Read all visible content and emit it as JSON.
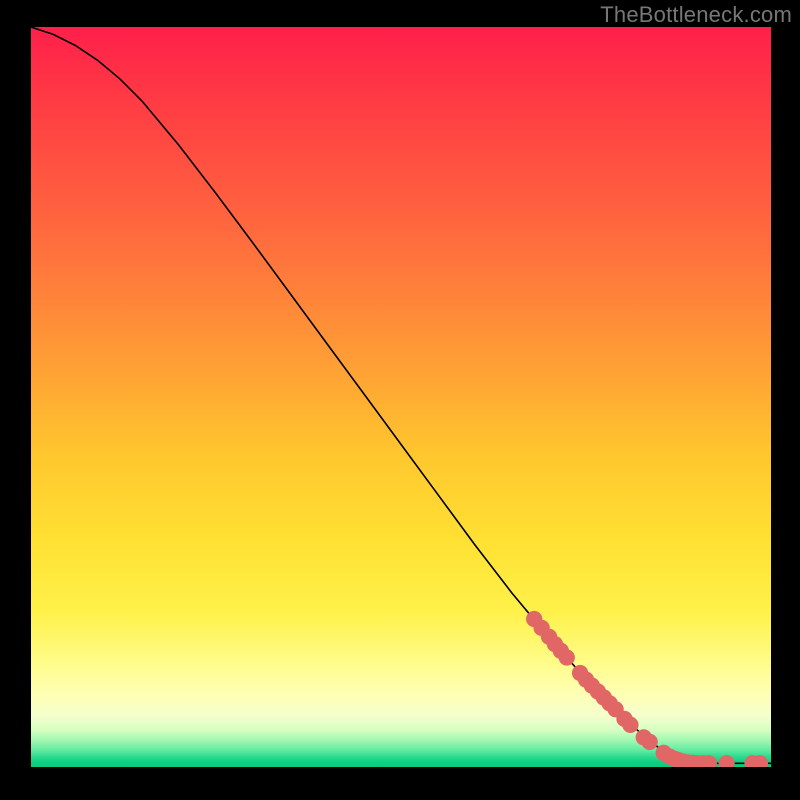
{
  "watermark": "TheBottleneck.com",
  "chart_data": {
    "type": "line",
    "title": "",
    "xlabel": "",
    "ylabel": "",
    "xlim": [
      0,
      100
    ],
    "ylim": [
      0,
      100
    ],
    "curve": [
      {
        "x": 0,
        "y": 100
      },
      {
        "x": 3,
        "y": 99.0
      },
      {
        "x": 6,
        "y": 97.5
      },
      {
        "x": 9,
        "y": 95.5
      },
      {
        "x": 12,
        "y": 93.0
      },
      {
        "x": 15,
        "y": 90.0
      },
      {
        "x": 20,
        "y": 84.0
      },
      {
        "x": 25,
        "y": 77.5
      },
      {
        "x": 30,
        "y": 70.8
      },
      {
        "x": 35,
        "y": 64.0
      },
      {
        "x": 40,
        "y": 57.2
      },
      {
        "x": 45,
        "y": 50.4
      },
      {
        "x": 50,
        "y": 43.6
      },
      {
        "x": 55,
        "y": 36.8
      },
      {
        "x": 60,
        "y": 30.0
      },
      {
        "x": 65,
        "y": 23.5
      },
      {
        "x": 70,
        "y": 17.5
      },
      {
        "x": 74,
        "y": 13.0
      },
      {
        "x": 78,
        "y": 8.8
      },
      {
        "x": 81,
        "y": 5.8
      },
      {
        "x": 84,
        "y": 3.2
      },
      {
        "x": 86,
        "y": 1.8
      },
      {
        "x": 88,
        "y": 0.9
      },
      {
        "x": 90,
        "y": 0.5
      },
      {
        "x": 93,
        "y": 0.5
      },
      {
        "x": 96,
        "y": 0.5
      },
      {
        "x": 100,
        "y": 0.5
      }
    ],
    "dot_clusters": [
      {
        "x": 68.0,
        "y": 20.0,
        "r": 1.1
      },
      {
        "x": 69.0,
        "y": 18.8,
        "r": 1.1
      },
      {
        "x": 70.0,
        "y": 17.6,
        "r": 1.1
      },
      {
        "x": 70.8,
        "y": 16.6,
        "r": 1.1
      },
      {
        "x": 71.6,
        "y": 15.7,
        "r": 1.1
      },
      {
        "x": 72.4,
        "y": 14.8,
        "r": 1.1
      },
      {
        "x": 74.2,
        "y": 12.7,
        "r": 1.1
      },
      {
        "x": 75.0,
        "y": 11.8,
        "r": 1.1
      },
      {
        "x": 75.8,
        "y": 11.0,
        "r": 1.1
      },
      {
        "x": 76.6,
        "y": 10.2,
        "r": 1.1
      },
      {
        "x": 77.4,
        "y": 9.4,
        "r": 1.1
      },
      {
        "x": 78.2,
        "y": 8.6,
        "r": 1.1
      },
      {
        "x": 79.0,
        "y": 7.8,
        "r": 1.1
      },
      {
        "x": 80.2,
        "y": 6.5,
        "r": 1.1
      },
      {
        "x": 81.0,
        "y": 5.7,
        "r": 1.1
      },
      {
        "x": 82.8,
        "y": 4.0,
        "r": 1.1
      },
      {
        "x": 83.6,
        "y": 3.4,
        "r": 1.1
      },
      {
        "x": 85.5,
        "y": 1.9,
        "r": 1.1
      },
      {
        "x": 86.3,
        "y": 1.4,
        "r": 1.1
      },
      {
        "x": 87.0,
        "y": 1.1,
        "r": 1.1
      },
      {
        "x": 87.6,
        "y": 0.9,
        "r": 1.1
      },
      {
        "x": 88.2,
        "y": 0.7,
        "r": 1.1
      },
      {
        "x": 88.8,
        "y": 0.6,
        "r": 1.1
      },
      {
        "x": 89.4,
        "y": 0.55,
        "r": 1.1
      },
      {
        "x": 90.0,
        "y": 0.5,
        "r": 1.1
      },
      {
        "x": 90.8,
        "y": 0.5,
        "r": 1.1
      },
      {
        "x": 91.6,
        "y": 0.5,
        "r": 1.1
      },
      {
        "x": 94.0,
        "y": 0.5,
        "r": 1.1
      },
      {
        "x": 97.5,
        "y": 0.5,
        "r": 1.1
      },
      {
        "x": 98.5,
        "y": 0.5,
        "r": 1.1
      }
    ],
    "colors": {
      "curve": "#000000",
      "dots": "#e16666"
    }
  }
}
